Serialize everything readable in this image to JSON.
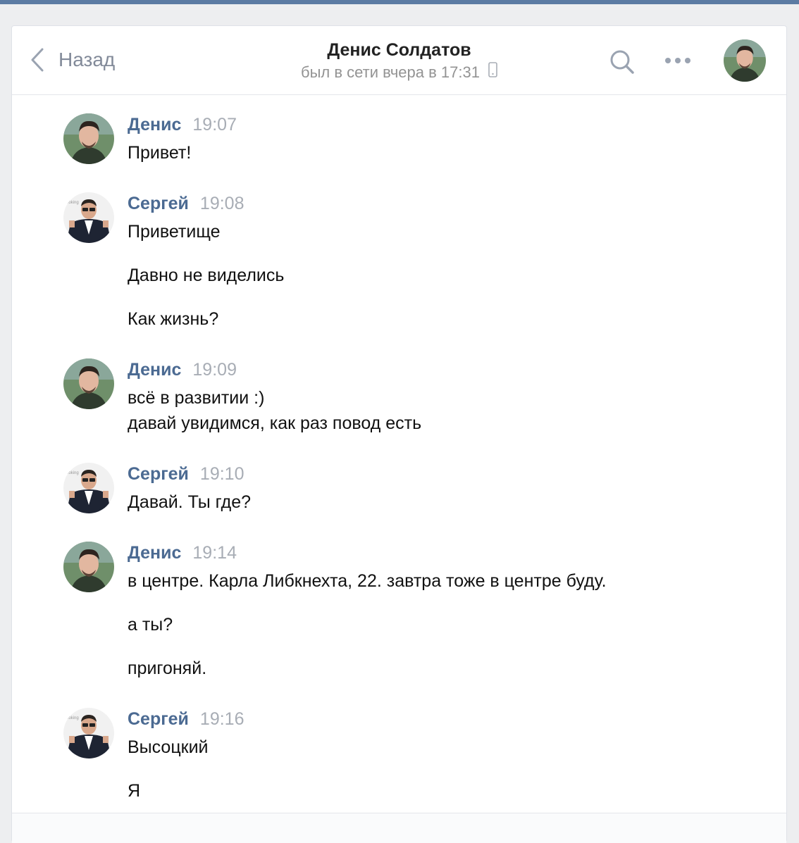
{
  "header": {
    "back_label": "Назад",
    "title": "Денис Солдатов",
    "subtitle": "был в сети вчера в 17:31"
  },
  "colors": {
    "accent": "#4b6a92",
    "topbar": "#5b7ba3",
    "background": "#edeef0"
  },
  "messages": [
    {
      "author": "Денис",
      "time": "19:07",
      "lines": [
        "Привет!"
      ]
    },
    {
      "author": "Сергей",
      "time": "19:08",
      "lines": [
        "Приветище",
        "Давно не виделись",
        "Как жизнь?"
      ]
    },
    {
      "author": "Денис",
      "time": "19:09",
      "lines": [
        "всё в развитии :)",
        "давай увидимся, как раз повод есть"
      ]
    },
    {
      "author": "Сергей",
      "time": "19:10",
      "lines": [
        "Давай. Ты где?"
      ]
    },
    {
      "author": "Денис",
      "time": "19:14",
      "lines": [
        "в центре. Карла Либкнехта, 22. завтра тоже в центре буду.",
        "а ты?",
        "пригоняй."
      ]
    },
    {
      "author": "Сергей",
      "time": "19:16",
      "lines": [
        "Высоцкий",
        "Я"
      ]
    }
  ]
}
